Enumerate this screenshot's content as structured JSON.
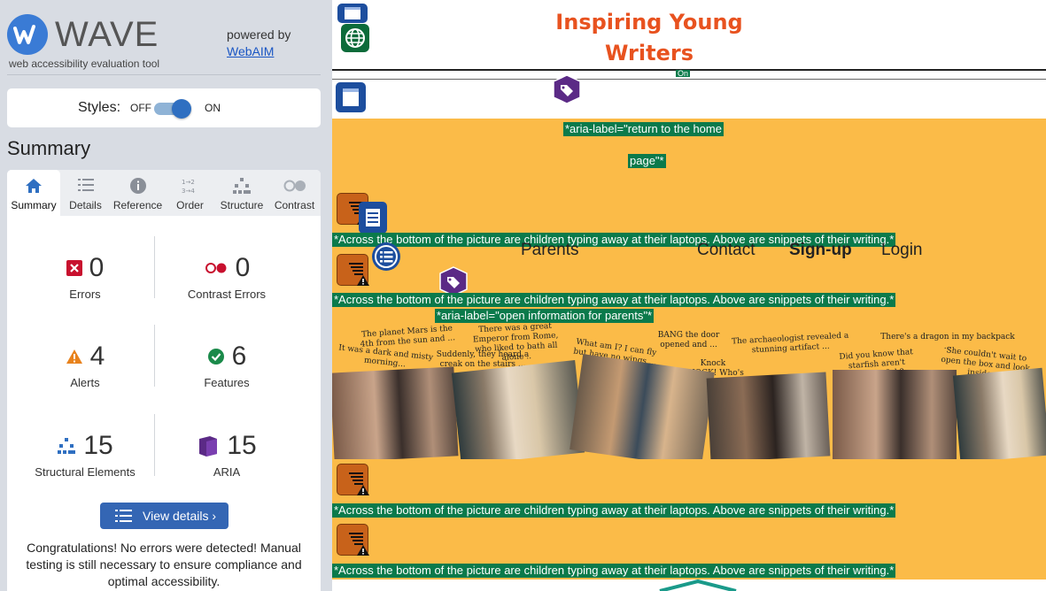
{
  "sidebar": {
    "logo_text": "WAVE",
    "tagline": "web accessibility evaluation tool",
    "powered_by": "powered by",
    "webaim_link": "WebAIM",
    "styles_label": "Styles:",
    "styles_off": "OFF",
    "styles_on": "ON",
    "summary_heading": "Summary",
    "tabs": [
      {
        "label": "Summary",
        "icon": "home-icon"
      },
      {
        "label": "Details",
        "icon": "list-icon"
      },
      {
        "label": "Reference",
        "icon": "info-icon"
      },
      {
        "label": "Order",
        "icon": "order-icon"
      },
      {
        "label": "Structure",
        "icon": "structure-icon"
      },
      {
        "label": "Contrast",
        "icon": "contrast-icon"
      }
    ],
    "stats": {
      "errors": {
        "value": "0",
        "label": "Errors"
      },
      "contrast_errors": {
        "value": "0",
        "label": "Contrast Errors"
      },
      "alerts": {
        "value": "4",
        "label": "Alerts"
      },
      "features": {
        "value": "6",
        "label": "Features"
      },
      "structural": {
        "value": "15",
        "label": "Structural Elements"
      },
      "aria": {
        "value": "15",
        "label": "ARIA"
      }
    },
    "view_details": "View details ›",
    "congrats": "Congratulations! No errors were detected! Manual testing is still necessary to ensure compliance and optimal accessibility."
  },
  "page": {
    "title_line1": "Inspiring Young",
    "title_line2": "Writers",
    "on_tab": "On",
    "aria_home_1": "*aria-label=\"return to the home",
    "aria_home_2": "page\"*",
    "alt_text": "*Across the bottom of the picture are children typing away at their laptops. Above are snippets of their writing.*",
    "aria_parents": "*aria-label=\"open information for parents\"*",
    "nav": {
      "parents": "Parents",
      "contact": "Contact",
      "signup": "Sign-up",
      "login": "Login"
    },
    "snippets": [
      "The planet Mars is the 4th from the sun and ...",
      "There was a great Emperor from Rome, who liked to bath all alone ..",
      "BANG the door opened and ...",
      "The archaeologist revealed a stunning artifact ...",
      "There's a dragon in my backpack ...",
      "It was a dark and misty morning...",
      "Suddenly, they heard a creak on the stairs ...",
      "What am I? I can fly but have no wings ...",
      "Knock KNOCK! Who's there?",
      "Did you know that starfish aren't actually fish?",
      "She couldn't wait to open the box and look inside ..."
    ]
  },
  "colors": {
    "sidebar_bg": "#d8dce3",
    "accent_blue": "#3466b4",
    "page_orange": "#fbbb48",
    "title_orange": "#e8521f",
    "wave_green": "#0b7a4b",
    "error_red": "#c8102e",
    "alert_orange": "#e8821c",
    "feature_green": "#1a8a4a",
    "aria_purple": "#5b2a86"
  }
}
